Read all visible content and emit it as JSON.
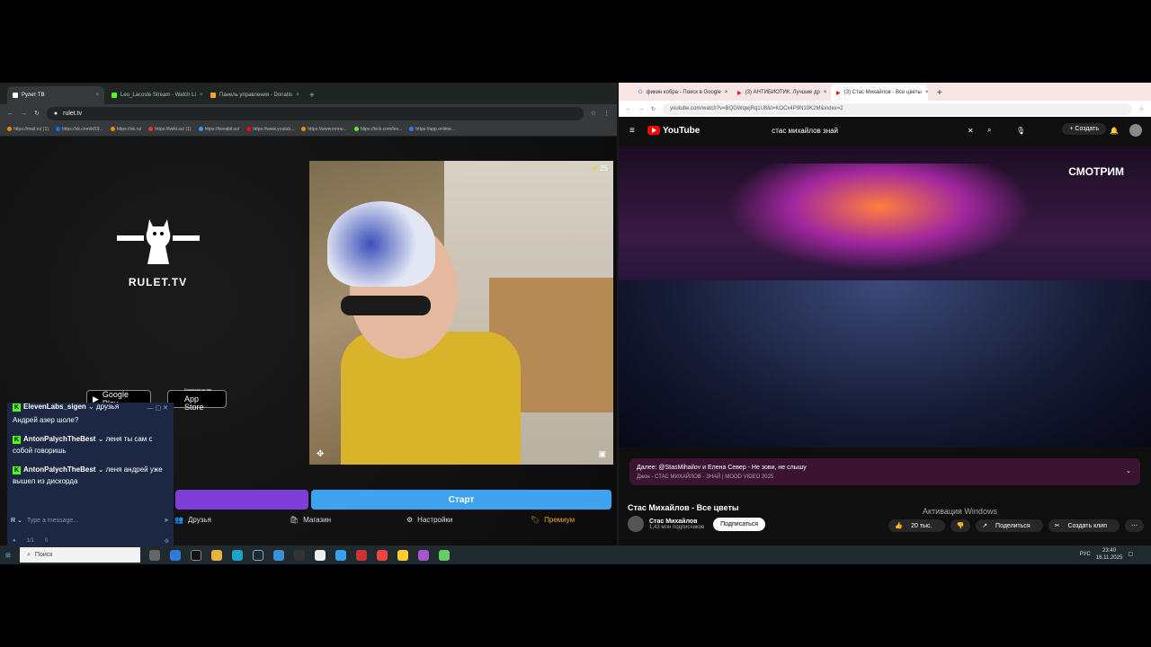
{
  "left_browser": {
    "tabs": [
      {
        "label": "Рулет ТВ",
        "active": true
      },
      {
        "label": "Leo_Lacoste Stream - Watch Li",
        "active": false
      },
      {
        "label": "Панель управления - Donatio",
        "active": false
      }
    ],
    "url": "rulet.tv",
    "bookmarks": [
      "https://mail.ru/ (1)",
      "https://vk.com/id19...",
      "https://ok.ru/",
      "https://twiki.su/ (1)",
      "https://kovabil.su/",
      "https://www.youtub...",
      "https://www.innou...",
      "https://kick.com/leo...",
      "https://app.onlime..."
    ]
  },
  "rulet": {
    "logo": "RULET.TV",
    "google_play": "Google Play",
    "app_store": "App Store",
    "app_store_small": "Download on the",
    "viewer_count": "25",
    "start_button": "Старт",
    "menu": {
      "friends": "Друзья",
      "shop": "Магазин",
      "settings": "Настройки",
      "premium": "Премиум"
    }
  },
  "chat": {
    "messages": [
      {
        "user": "AntonPalychTheBest",
        "text": "Андрей азер шоле?",
        "partial_user": "ElevenLabs_sigen",
        "partial_text": "друзья"
      },
      {
        "user": "AntonPalychTheBest",
        "text": "леня ты сам с собой говоришь"
      },
      {
        "user": "AntonPalychTheBest",
        "text": "леня андрей уже вышел из дискорда"
      }
    ],
    "placeholder": "Type a message...",
    "count": "1/1",
    "views": "0"
  },
  "right_browser": {
    "tabs": [
      {
        "label": "фикин кобра - Поиск в Google",
        "active": false
      },
      {
        "label": "(3) АНТИБИОТИК. Лучшие др",
        "active": false
      },
      {
        "label": "(3) Стас Михайлов - Все цветы",
        "active": true
      }
    ],
    "url": "youtube.com/watch?v=BQGWqwjRq1U8&t=KOCx4P9N10K2M&index=2"
  },
  "youtube": {
    "logo": "YouTube",
    "search_query": "стас михайлов знай",
    "create": "Создать",
    "channel_badge": "СМОТРИМ",
    "next": "Далее: @StasMihailov и Елена Север - Не зови, не слышу",
    "next_sub": "Джон - СТАС МИХАЙЛОВ - ЗНАЙ | MOOD VIDEO 2025",
    "title": "Стас Михайлов - Все цветы",
    "channel": "Стас Михайлов",
    "subscribers": "1,43 млн подписчиков",
    "subscribe": "Подписаться",
    "likes": "20 тыс.",
    "share": "Поделиться",
    "clip": "Создать клип",
    "watermark": "Активация Windows"
  },
  "taskbar": {
    "search": "Поиск",
    "lang": "РУС",
    "time": "23:40",
    "date": "16.11.2025"
  },
  "colors": {
    "accent_purple": "#7b3fd8",
    "accent_blue": "#3fa3f0",
    "kick_green": "#53fc18"
  }
}
